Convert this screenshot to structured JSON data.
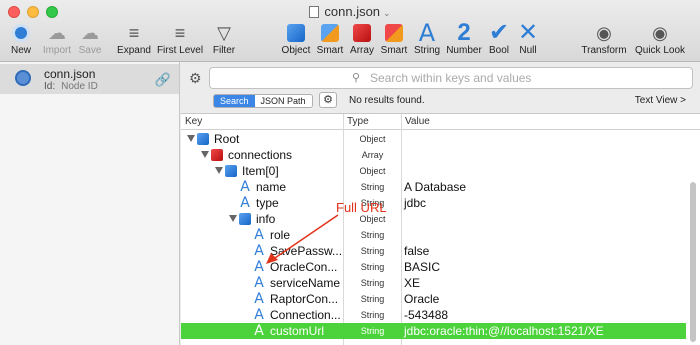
{
  "window": {
    "title": "conn.json"
  },
  "toolbar": {
    "new": "New",
    "import": "Import",
    "save": "Save",
    "expand": "Expand",
    "first_level": "First Level",
    "filter": "Filter",
    "object": "Object",
    "smart_obj": "Smart",
    "array": "Array",
    "smart_arr": "Smart",
    "string": "String",
    "number": "Number",
    "bool": "Bool",
    "null": "Null",
    "transform": "Transform",
    "quick_look": "Quick Look"
  },
  "sidebar": {
    "name": "conn.json",
    "id_label": "Id:",
    "id_value": "Node ID"
  },
  "search": {
    "placeholder": "Search within keys and values",
    "tab_search": "Search",
    "tab_jsonpath": "JSON Path",
    "status": "No results found.",
    "text_view": "Text View >"
  },
  "table": {
    "col_key": "Key",
    "col_type": "Type",
    "col_value": "Value",
    "rows": [
      {
        "key": "Root",
        "type": "Object",
        "value": ""
      },
      {
        "key": "connections",
        "type": "Array",
        "value": ""
      },
      {
        "key": "Item[0]",
        "type": "Object",
        "value": ""
      },
      {
        "key": "name",
        "type": "String",
        "value": "A Database"
      },
      {
        "key": "type",
        "type": "String",
        "value": "jdbc"
      },
      {
        "key": "info",
        "type": "Object",
        "value": ""
      },
      {
        "key": "role",
        "type": "String",
        "value": ""
      },
      {
        "key": "SavePassw...",
        "type": "String",
        "value": "false"
      },
      {
        "key": "OracleCon...",
        "type": "String",
        "value": "BASIC"
      },
      {
        "key": "serviceName",
        "type": "String",
        "value": "XE"
      },
      {
        "key": "RaptorCon...",
        "type": "String",
        "value": "Oracle"
      },
      {
        "key": "Connection...",
        "type": "String",
        "value": "-543488"
      },
      {
        "key": "customUrl",
        "type": "String",
        "value": "jdbc:oracle:thin:@//localhost:1521/XE"
      }
    ]
  },
  "annotation": {
    "text": "Full URL",
    "color": "#e2331b"
  },
  "colors": {
    "selection": "#4cd23a",
    "accent": "#3b86e6"
  }
}
